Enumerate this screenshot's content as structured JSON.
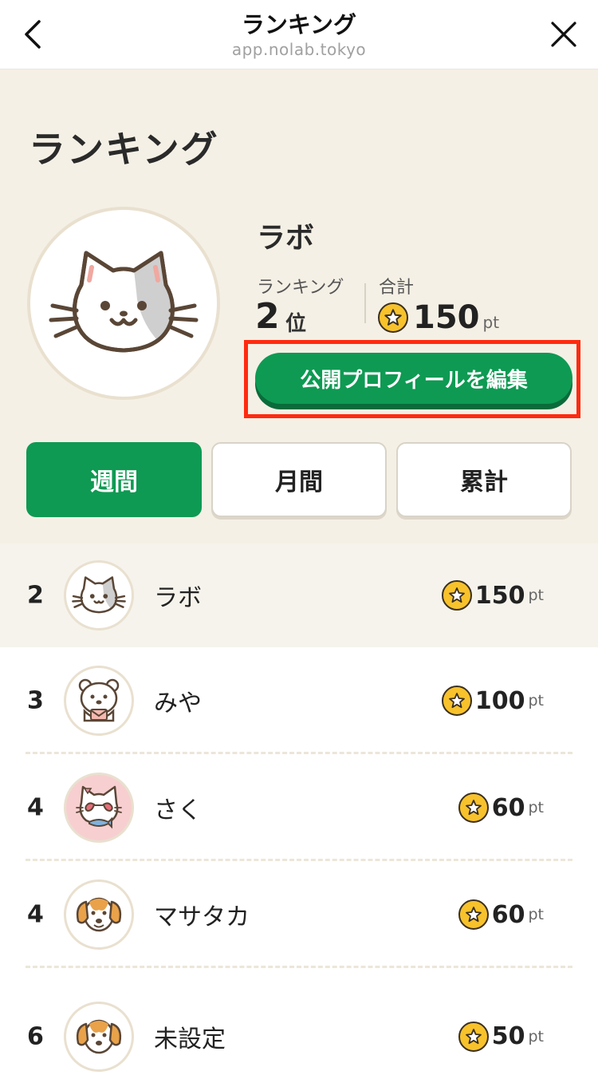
{
  "nav": {
    "title": "ランキング",
    "url": "app.nolab.tokyo"
  },
  "header": {
    "title": "ランキング",
    "user": {
      "name": "ラボ",
      "rank_label": "ランキング",
      "rank_value": "2",
      "rank_unit": "位",
      "total_label": "合計",
      "total_points": "150",
      "points_unit": "pt"
    },
    "edit_profile_label": "公開プロフィールを編集"
  },
  "tabs": [
    {
      "label": "週間",
      "active": true
    },
    {
      "label": "月間",
      "active": false
    },
    {
      "label": "累計",
      "active": false
    }
  ],
  "ranking": [
    {
      "rank": "2",
      "name": "ラボ",
      "points": "150",
      "unit": "pt",
      "avatar": "cat-icon",
      "is_self": true
    },
    {
      "rank": "3",
      "name": "みや",
      "points": "100",
      "unit": "pt",
      "avatar": "bear-icon",
      "is_self": false
    },
    {
      "rank": "4",
      "name": "さく",
      "points": "60",
      "unit": "pt",
      "avatar": "cat-sunglasses-icon",
      "is_self": false
    },
    {
      "rank": "4",
      "name": "マサタカ",
      "points": "60",
      "unit": "pt",
      "avatar": "dog-icon",
      "is_self": false
    },
    {
      "rank": "6",
      "name": "未設定",
      "points": "50",
      "unit": "pt",
      "avatar": "dog-icon",
      "is_self": false
    }
  ],
  "colors": {
    "accent_green": "#0e9a53",
    "hero_background": "#f5f0e5",
    "highlight_red": "#ff2a0f",
    "coin_yellow": "#f7c22c"
  }
}
